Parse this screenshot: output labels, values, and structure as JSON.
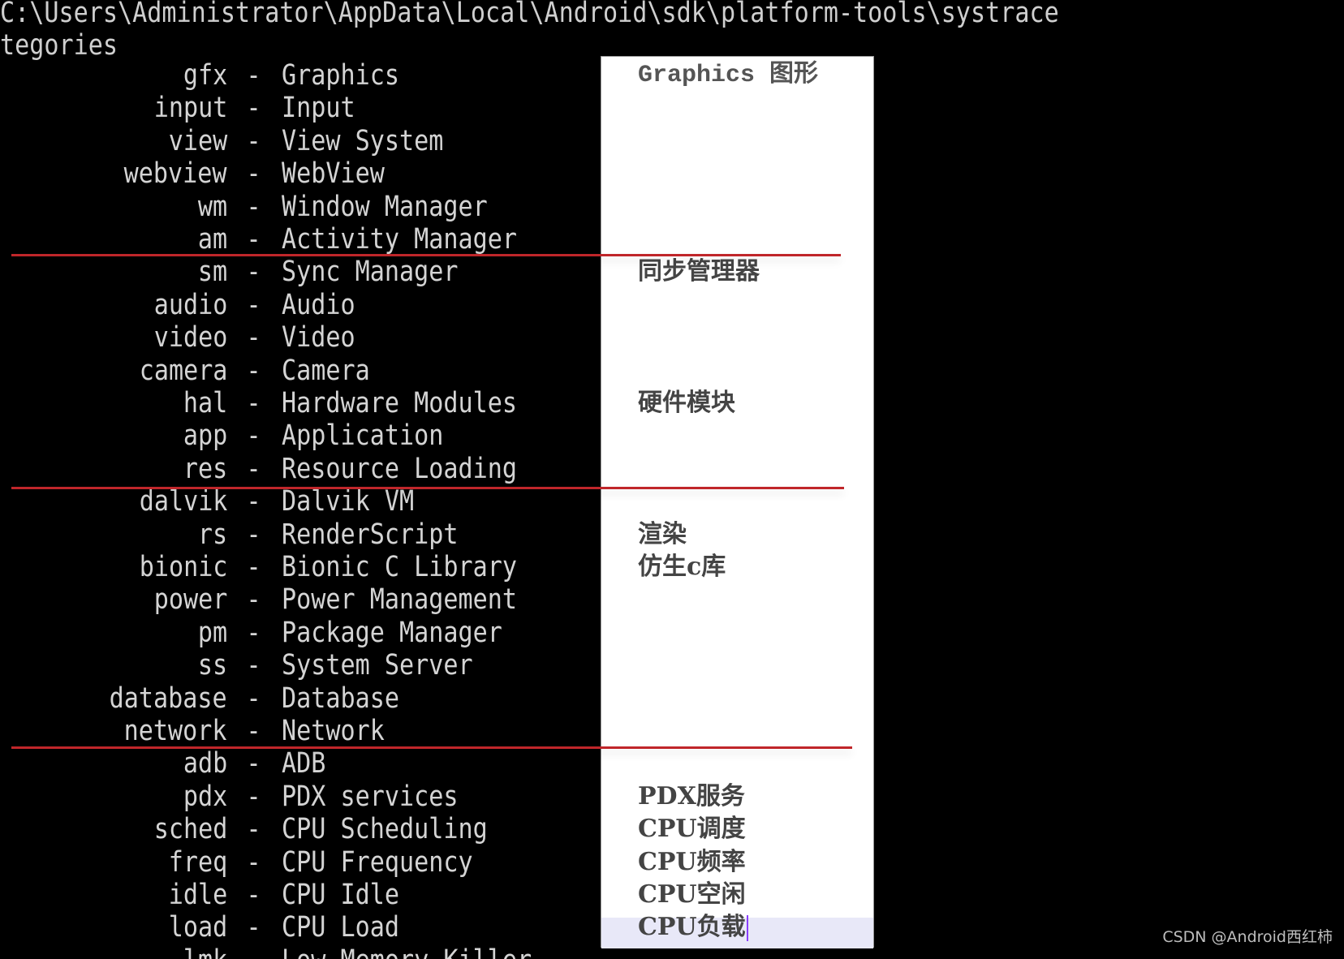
{
  "terminal": {
    "path_line": "C:\\Users\\Administrator\\AppData\\Local\\Android\\sdk\\platform-tools\\systrace",
    "categories_line": "tegories",
    "separator": "-",
    "rows": [
      {
        "key": "gfx",
        "desc": "Graphics"
      },
      {
        "key": "input",
        "desc": "Input"
      },
      {
        "key": "view",
        "desc": "View System"
      },
      {
        "key": "webview",
        "desc": "WebView"
      },
      {
        "key": "wm",
        "desc": "Window Manager"
      },
      {
        "key": "am",
        "desc": "Activity Manager"
      },
      {
        "key": "sm",
        "desc": "Sync Manager"
      },
      {
        "key": "audio",
        "desc": "Audio"
      },
      {
        "key": "video",
        "desc": "Video"
      },
      {
        "key": "camera",
        "desc": "Camera"
      },
      {
        "key": "hal",
        "desc": "Hardware Modules"
      },
      {
        "key": "app",
        "desc": "Application"
      },
      {
        "key": "res",
        "desc": "Resource Loading"
      },
      {
        "key": "dalvik",
        "desc": "Dalvik VM"
      },
      {
        "key": "rs",
        "desc": "RenderScript"
      },
      {
        "key": "bionic",
        "desc": "Bionic C Library"
      },
      {
        "key": "power",
        "desc": "Power Management"
      },
      {
        "key": "pm",
        "desc": "Package Manager"
      },
      {
        "key": "ss",
        "desc": "System Server"
      },
      {
        "key": "database",
        "desc": "Database"
      },
      {
        "key": "network",
        "desc": "Network"
      },
      {
        "key": "adb",
        "desc": "ADB"
      },
      {
        "key": "pdx",
        "desc": "PDX services"
      },
      {
        "key": "sched",
        "desc": "CPU Scheduling"
      },
      {
        "key": "freq",
        "desc": "CPU Frequency"
      },
      {
        "key": "idle",
        "desc": "CPU Idle"
      },
      {
        "key": "load",
        "desc": "CPU Load"
      },
      {
        "key": "lmk",
        "desc": "Low Memory Killer"
      }
    ]
  },
  "annotations": {
    "notes": [
      {
        "row": 0,
        "text": "Graphics 图形"
      },
      {
        "row": 6,
        "text": "同步管理器"
      },
      {
        "row": 10,
        "text": "硬件模块"
      },
      {
        "row": 14,
        "text": "渲染"
      },
      {
        "row": 15,
        "text": "仿生c库"
      },
      {
        "row": 22,
        "text": "PDX服务"
      },
      {
        "row": 23,
        "text": "CPU调度"
      },
      {
        "row": 24,
        "text": "CPU频率"
      },
      {
        "row": 25,
        "text": "CPU空闲"
      },
      {
        "row": 26,
        "text": "CPU负载"
      }
    ],
    "divider_color": "#c0262a",
    "highlight_color": "#e8e8f8"
  },
  "watermark": "CSDN @Android西红柿"
}
